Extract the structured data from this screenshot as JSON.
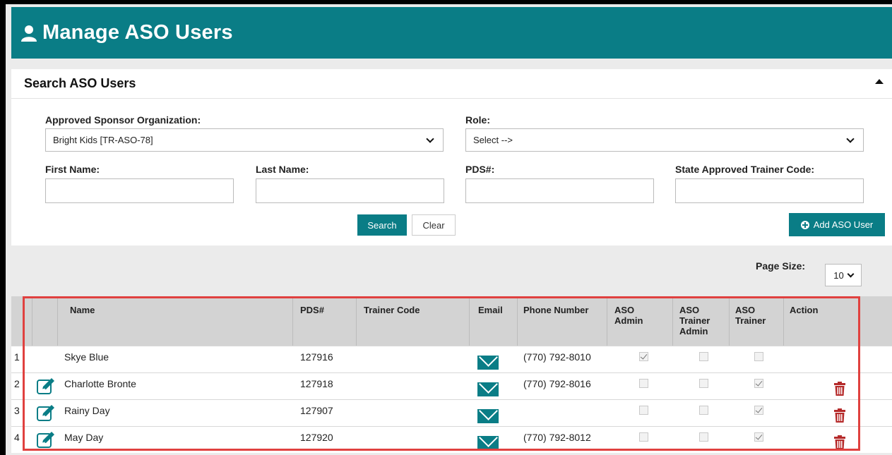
{
  "header": {
    "title": "Manage ASO Users",
    "icon": "user-icon"
  },
  "search_panel": {
    "title": "Search ASO Users",
    "aso_label": "Approved Sponsor Organization:",
    "aso_value": "Bright Kids [TR-ASO-78]",
    "role_label": "Role:",
    "role_value": "Select -->",
    "first_name_label": "First Name:",
    "last_name_label": "Last Name:",
    "pds_label": "PDS#:",
    "trainer_code_label": "State Approved Trainer Code:",
    "search_button": "Search",
    "clear_button": "Clear",
    "add_button": "Add ASO User"
  },
  "page_size": {
    "label": "Page Size:",
    "value": "10"
  },
  "table": {
    "columns": {
      "name": "Name",
      "pds": "PDS#",
      "trainer_code": "Trainer Code",
      "email": "Email",
      "phone": "Phone Number",
      "aso_admin": "ASO Admin",
      "aso_trainer_admin": "ASO Trainer Admin",
      "aso_trainer": "ASO Trainer",
      "action": "Action"
    },
    "rows": [
      {
        "num": "1",
        "name": "Skye Blue",
        "pds": "127916",
        "trainer_code": "",
        "phone": "(770) 792-8010",
        "aso_admin": true,
        "aso_trainer_admin": false,
        "aso_trainer": false,
        "editable": false
      },
      {
        "num": "2",
        "name": "Charlotte Bronte",
        "pds": "127918",
        "trainer_code": "",
        "phone": "(770) 792-8016",
        "aso_admin": false,
        "aso_trainer_admin": false,
        "aso_trainer": true,
        "editable": true
      },
      {
        "num": "3",
        "name": "Rainy Day",
        "pds": "127907",
        "trainer_code": "",
        "phone": "",
        "aso_admin": false,
        "aso_trainer_admin": false,
        "aso_trainer": true,
        "editable": true
      },
      {
        "num": "4",
        "name": "May Day",
        "pds": "127920",
        "trainer_code": "",
        "phone": "(770) 792-8012",
        "aso_admin": false,
        "aso_trainer_admin": false,
        "aso_trainer": true,
        "editable": true
      }
    ]
  },
  "colors": {
    "brand": "#0a7d86",
    "danger": "#c0392b",
    "highlight": "#e0413f"
  }
}
